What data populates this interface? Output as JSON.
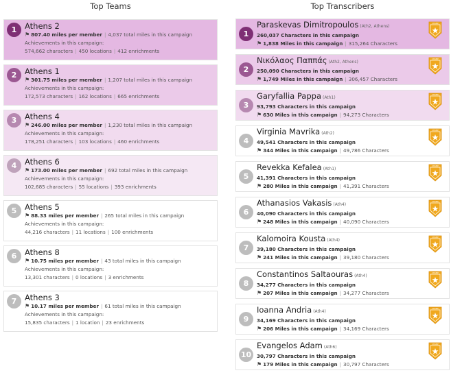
{
  "teams": {
    "title": "Top Teams",
    "achievements_label": "Achievements in this campaign:",
    "items": [
      {
        "rank": "1",
        "name": "Athens 2",
        "miles_per_member": "807.40 miles per member",
        "total_miles": "4,037 total miles in this campaign",
        "characters": "574,662 characters",
        "locations": "450 locations",
        "enrichments": "412 enrichments",
        "bg": "#e4b8e2",
        "badge": "#7e2f74"
      },
      {
        "rank": "2",
        "name": "Athens 1",
        "miles_per_member": "301.75 miles per member",
        "total_miles": "1,207 total miles in this campaign",
        "characters": "172,573 characters",
        "locations": "162 locations",
        "enrichments": "665 enrichments",
        "bg": "#ebcae9",
        "badge": "#9b5892"
      },
      {
        "rank": "3",
        "name": "Athens 4",
        "miles_per_member": "246.00 miles per member",
        "total_miles": "1,230 total miles in this campaign",
        "characters": "178,251 characters",
        "locations": "103 locations",
        "enrichments": "460 enrichments",
        "bg": "#f1dbef",
        "badge": "#b688b0"
      },
      {
        "rank": "4",
        "name": "Athens 6",
        "miles_per_member": "173.00 miles per member",
        "total_miles": "692 total miles in this campaign",
        "characters": "102,685 characters",
        "locations": "55 locations",
        "enrichments": "393 enrichments",
        "bg": "#f5e8f4",
        "badge": "#bfa3bb"
      },
      {
        "rank": "5",
        "name": "Athens 5",
        "miles_per_member": "88.33 miles per member",
        "total_miles": "265 total miles in this campaign",
        "characters": "44,216 characters",
        "locations": "11 locations",
        "enrichments": "100 enrichments",
        "bg": "#ffffff",
        "badge": "#bdbdbd"
      },
      {
        "rank": "6",
        "name": "Athens 8",
        "miles_per_member": "10.75 miles per member",
        "total_miles": "43 total miles in this campaign",
        "characters": "13,301 characters",
        "locations": "0 locations",
        "enrichments": "3 enrichments",
        "bg": "#ffffff",
        "badge": "#bdbdbd"
      },
      {
        "rank": "7",
        "name": "Athens 3",
        "miles_per_member": "10.17 miles per member",
        "total_miles": "61 total miles in this campaign",
        "characters": "15,835 characters",
        "locations": "1 location",
        "enrichments": "23 enrichments",
        "bg": "#ffffff",
        "badge": "#bdbdbd"
      }
    ]
  },
  "transcribers": {
    "title": "Top Transcribers",
    "champ_label": "CHAMP",
    "items": [
      {
        "rank": "1",
        "name": "Paraskevas Dimitropoulos",
        "teams": "(Ath2, Athens)",
        "characters_campaign": "260,037 Characters in this campaign",
        "miles": "1,838 Miles in this campaign",
        "characters_total": "315,264 Characters",
        "bg": "#e4b8e2",
        "badge": "#7e2f74"
      },
      {
        "rank": "2",
        "name": "Νικόλαος Παππάς",
        "teams": "(Ath2, Athens)",
        "characters_campaign": "250,090 Characters in this campaign",
        "miles": "1,749 Miles in this campaign",
        "characters_total": "306,457 Characters",
        "bg": "#ebcae9",
        "badge": "#9b5892"
      },
      {
        "rank": "3",
        "name": "Garyfallia Pappa",
        "teams": "(Ath1)",
        "characters_campaign": "93,793 Characters in this campaign",
        "miles": "630 Miles in this campaign",
        "characters_total": "94,273 Characters",
        "bg": "#f1dbef",
        "badge": "#b688b0"
      },
      {
        "rank": "4",
        "name": "Virginia Mavrika",
        "teams": "(Ath2)",
        "characters_campaign": "49,541 Characters in this campaign",
        "miles": "344 Miles in this campaign",
        "characters_total": "49,786 Characters",
        "bg": "#ffffff",
        "badge": "#bdbdbd"
      },
      {
        "rank": "5",
        "name": "Revekka Kefalea",
        "teams": "(Ath1)",
        "characters_campaign": "41,391 Characters in this campaign",
        "miles": "280 Miles in this campaign",
        "characters_total": "41,391 Characters",
        "bg": "#ffffff",
        "badge": "#bdbdbd"
      },
      {
        "rank": "6",
        "name": "Athanasios Vakasis",
        "teams": "(Ath4)",
        "characters_campaign": "40,090 Characters in this campaign",
        "miles": "248 Miles in this campaign",
        "characters_total": "40,090 Characters",
        "bg": "#ffffff",
        "badge": "#bdbdbd"
      },
      {
        "rank": "7",
        "name": "Kalomoira Kousta",
        "teams": "(Ath4)",
        "characters_campaign": "39,180 Characters in this campaign",
        "miles": "241 Miles in this campaign",
        "characters_total": "39,180 Characters",
        "bg": "#ffffff",
        "badge": "#bdbdbd"
      },
      {
        "rank": "8",
        "name": "Constantinos Saltaouras",
        "teams": "(Ath4)",
        "characters_campaign": "34,277 Characters in this campaign",
        "miles": "207 Miles in this campaign",
        "characters_total": "34,277 Characters",
        "bg": "#ffffff",
        "badge": "#bdbdbd"
      },
      {
        "rank": "9",
        "name": "Ioanna Andria",
        "teams": "(Ath4)",
        "characters_campaign": "34,169 Characters in this campaign",
        "miles": "206 Miles in this campaign",
        "characters_total": "34,169 Characters",
        "bg": "#ffffff",
        "badge": "#bdbdbd"
      },
      {
        "rank": "10",
        "name": "Evangelos Adam",
        "teams": "(Ath6)",
        "characters_campaign": "30,797 Characters in this campaign",
        "miles": "179 Miles in this campaign",
        "characters_total": "30,797 Characters",
        "bg": "#ffffff",
        "badge": "#bdbdbd"
      }
    ]
  },
  "icons": {
    "flag": "flag-icon",
    "champ": "champ-shield-icon"
  },
  "colors": {
    "champ_gold": "#f0a81e",
    "champ_star": "#ffffff"
  }
}
